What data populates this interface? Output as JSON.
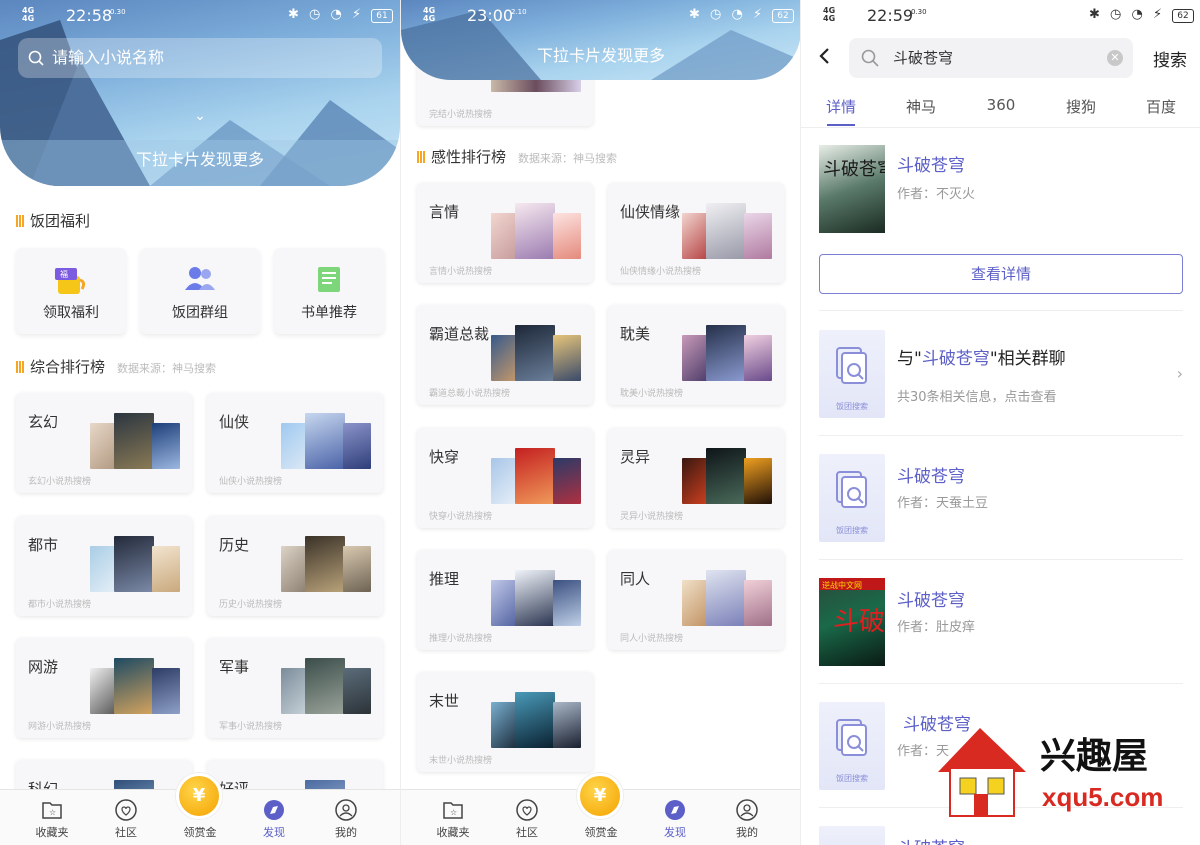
{
  "panel1": {
    "status": {
      "time": "22:58",
      "net": "0.30",
      "battery": "61"
    },
    "search": {
      "placeholder": "请输入小说名称"
    },
    "pull": "下拉卡片发现更多",
    "welfare": {
      "title": "饭团福利",
      "items": [
        {
          "label": "领取福利",
          "icon": "gift-icon"
        },
        {
          "label": "饭团群组",
          "icon": "group-icon"
        },
        {
          "label": "书单推荐",
          "icon": "booklist-icon"
        }
      ]
    },
    "ranking": {
      "title": "综合排行榜",
      "source": "数据来源：神马搜索",
      "cards": [
        {
          "title": "玄幻",
          "sub": "玄幻小说热搜榜"
        },
        {
          "title": "仙侠",
          "sub": "仙侠小说热搜榜"
        },
        {
          "title": "都市",
          "sub": "都市小说热搜榜"
        },
        {
          "title": "历史",
          "sub": "历史小说热搜榜"
        },
        {
          "title": "网游",
          "sub": "网游小说热搜榜"
        },
        {
          "title": "军事",
          "sub": "军事小说热搜榜"
        },
        {
          "title": "科幻",
          "sub": ""
        },
        {
          "title": "好评",
          "sub": ""
        }
      ]
    }
  },
  "panel2": {
    "status": {
      "time": "23:00",
      "net": "2.10",
      "battery": "62"
    },
    "pull": "下拉卡片发现更多",
    "prev_sub": "完结小说热搜榜",
    "ranking": {
      "title": "感性排行榜",
      "source": "数据来源：神马搜索",
      "cards": [
        {
          "title": "言情",
          "sub": "言情小说热搜榜"
        },
        {
          "title": "仙侠情缘",
          "sub": "仙侠情缘小说热搜榜"
        },
        {
          "title": "霸道总裁",
          "sub": "霸道总裁小说热搜榜"
        },
        {
          "title": "耽美",
          "sub": "耽美小说热搜榜"
        },
        {
          "title": "快穿",
          "sub": "快穿小说热搜榜"
        },
        {
          "title": "灵异",
          "sub": "灵异小说热搜榜"
        },
        {
          "title": "推理",
          "sub": "推理小说热搜榜"
        },
        {
          "title": "同人",
          "sub": "同人小说热搜榜"
        },
        {
          "title": "末世",
          "sub": "末世小说热搜榜"
        }
      ]
    }
  },
  "tabbar": {
    "items": [
      {
        "label": "收藏夹",
        "icon": "favorites-icon"
      },
      {
        "label": "社区",
        "icon": "community-icon"
      },
      {
        "label": "领赏金",
        "icon": "reward-coin-icon"
      },
      {
        "label": "发现",
        "icon": "discover-icon"
      },
      {
        "label": "我的",
        "icon": "profile-icon"
      }
    ],
    "coin": "¥"
  },
  "panel3": {
    "status": {
      "time": "22:59",
      "net": "0.30",
      "battery": "62"
    },
    "query": "斗破苍穹",
    "search_button": "搜索",
    "tabs": [
      "详情",
      "神马",
      "360",
      "搜狗",
      "百度"
    ],
    "results": [
      {
        "title": "斗破苍穹",
        "author": "作者：不灭火"
      },
      {
        "title": "斗破苍穹",
        "author": "作者：天蚕土豆"
      },
      {
        "title": "斗破苍穹",
        "author": "作者：肚皮痒"
      },
      {
        "title": "斗破苍穹",
        "author": "作者：天"
      },
      {
        "title": "斗破苍穹",
        "author": ""
      }
    ],
    "detail_button": "查看详情",
    "group": {
      "prefix": "与\"",
      "name": "斗破苍穹",
      "suffix": "\"相关群聊",
      "info": "共30条相关信息，点击查看"
    },
    "placeholder_label": "饭团搜索",
    "cover_text": [
      "斗破苍穹",
      "逆战中文网",
      "斗破苍穹"
    ]
  },
  "watermark": {
    "name": "兴趣屋",
    "url": "xqu5.com"
  },
  "colors": {
    "accent": "#5b5fc7",
    "gold": "#f5a623"
  }
}
